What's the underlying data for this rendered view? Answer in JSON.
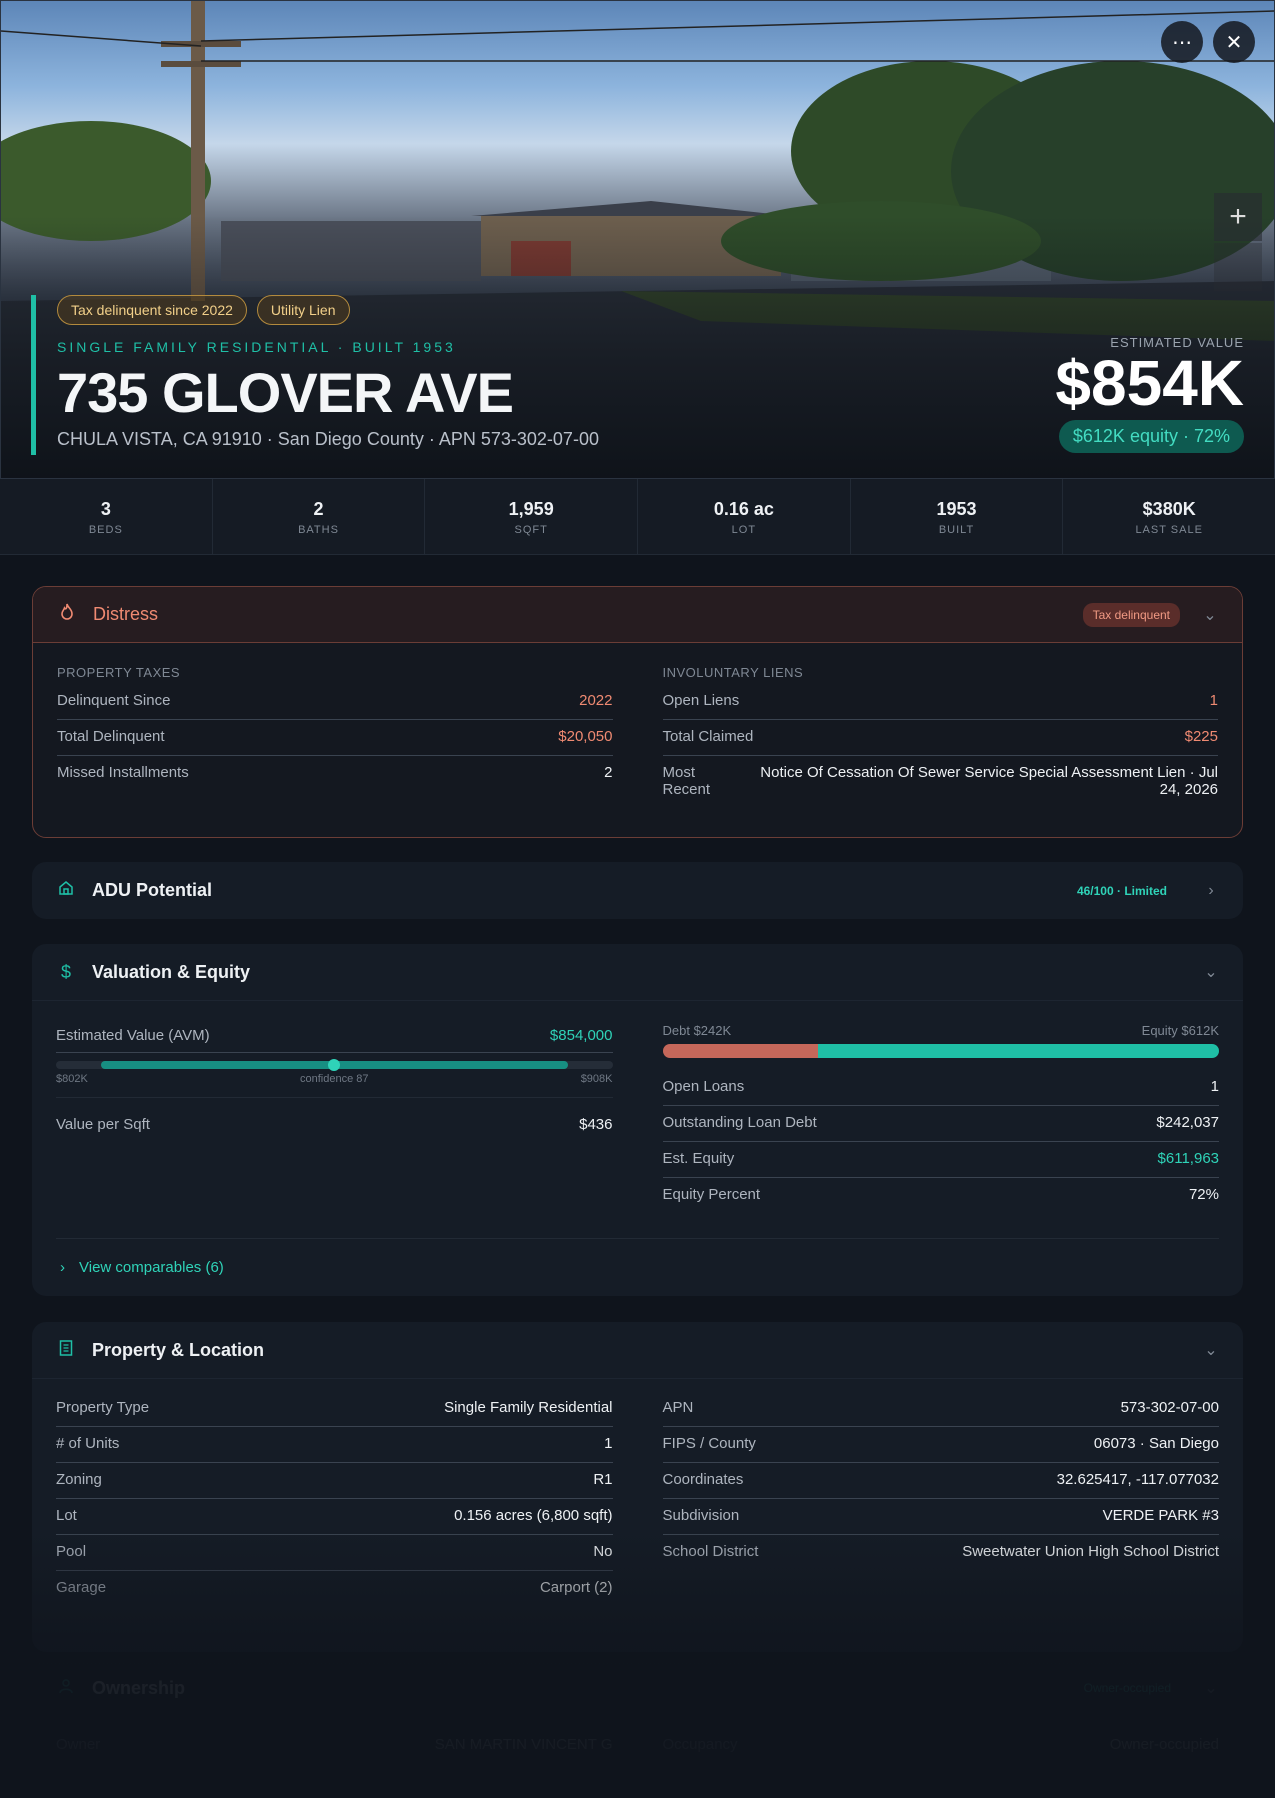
{
  "hero": {
    "tags": [
      "Tax delinquent since 2022",
      "Utility Lien"
    ],
    "kicker": "SINGLE FAMILY RESIDENTIAL · BUILT 1953",
    "street": "735 GLOVER AVE",
    "location": "CHULA VISTA, CA 91910 · San Diego County · APN 573-302-07-00",
    "est_label": "ESTIMATED VALUE",
    "est_value": "$854K",
    "equity": "$612K equity · 72%",
    "more_icon": "⋯",
    "close_icon": "✕",
    "zoom_icon": "+"
  },
  "stats": [
    {
      "value": "3",
      "label": "BEDS"
    },
    {
      "value": "2",
      "label": "BATHS"
    },
    {
      "value": "1,959",
      "label": "SQFT"
    },
    {
      "value": "0.16 ac",
      "label": "LOT"
    },
    {
      "value": "1953",
      "label": "BUILT"
    },
    {
      "value": "$380K",
      "label": "LAST SALE"
    }
  ],
  "distress": {
    "title": "Distress",
    "badge": "Tax delinquent",
    "taxes_label": "PROPERTY TAXES",
    "taxes": [
      {
        "k": "Delinquent Since",
        "v": "2022"
      },
      {
        "k": "Total Delinquent",
        "v": "$20,050"
      },
      {
        "k": "Missed Installments",
        "v": "2"
      }
    ],
    "liens_label": "INVOLUNTARY LIENS",
    "liens": [
      {
        "k": "Open Liens",
        "v": "1"
      },
      {
        "k": "Total Claimed",
        "v": "$225"
      },
      {
        "k": "Most Recent",
        "v": "Notice Of Cessation Of Sewer Service Special Assessment Lien · Jul 24, 2026"
      }
    ]
  },
  "adu": {
    "title": "ADU Potential",
    "badge": "46/100 · Limited"
  },
  "valuation": {
    "title": "Valuation & Equity",
    "avm_label": "Estimated Value (AVM)",
    "avm_value": "$854,000",
    "avm_low": "$802K",
    "avm_conf": "confidence 87",
    "avm_high": "$908K",
    "psf_label": "Value per Sqft",
    "psf_value": "$436",
    "debt_label": "Debt $242K",
    "equity_label": "Equity $612K",
    "equity_fraction": 0.72,
    "rows": [
      {
        "k": "Open Loans",
        "v": "1"
      },
      {
        "k": "Outstanding Loan Debt",
        "v": "$242,037"
      },
      {
        "k": "Est. Equity",
        "v": "$611,963"
      },
      {
        "k": "Equity Percent",
        "v": "72%"
      }
    ],
    "comps": "View comparables (6)"
  },
  "property": {
    "title": "Property & Location",
    "left": [
      {
        "k": "Property Type",
        "v": "Single Family Residential"
      },
      {
        "k": "# of Units",
        "v": "1"
      },
      {
        "k": "Zoning",
        "v": "R1"
      },
      {
        "k": "Lot",
        "v": "0.156 acres (6,800 sqft)"
      },
      {
        "k": "Pool",
        "v": "No"
      },
      {
        "k": "Garage",
        "v": "Carport (2)"
      }
    ],
    "right": [
      {
        "k": "APN",
        "v": "573-302-07-00"
      },
      {
        "k": "FIPS / County",
        "v": "06073 · San Diego"
      },
      {
        "k": "Coordinates",
        "v": "32.625417, -117.077032"
      },
      {
        "k": "Subdivision",
        "v": "VERDE PARK #3"
      },
      {
        "k": "School District",
        "v": "Sweetwater Union High School District"
      }
    ]
  },
  "ownership": {
    "title": "Ownership",
    "badge": "Owner-occupied",
    "owner_label": "Owner",
    "owner_value": "SAN MARTIN VINCENT G",
    "occ_label": "Occupancy",
    "occ_value": "Owner-occupied"
  }
}
